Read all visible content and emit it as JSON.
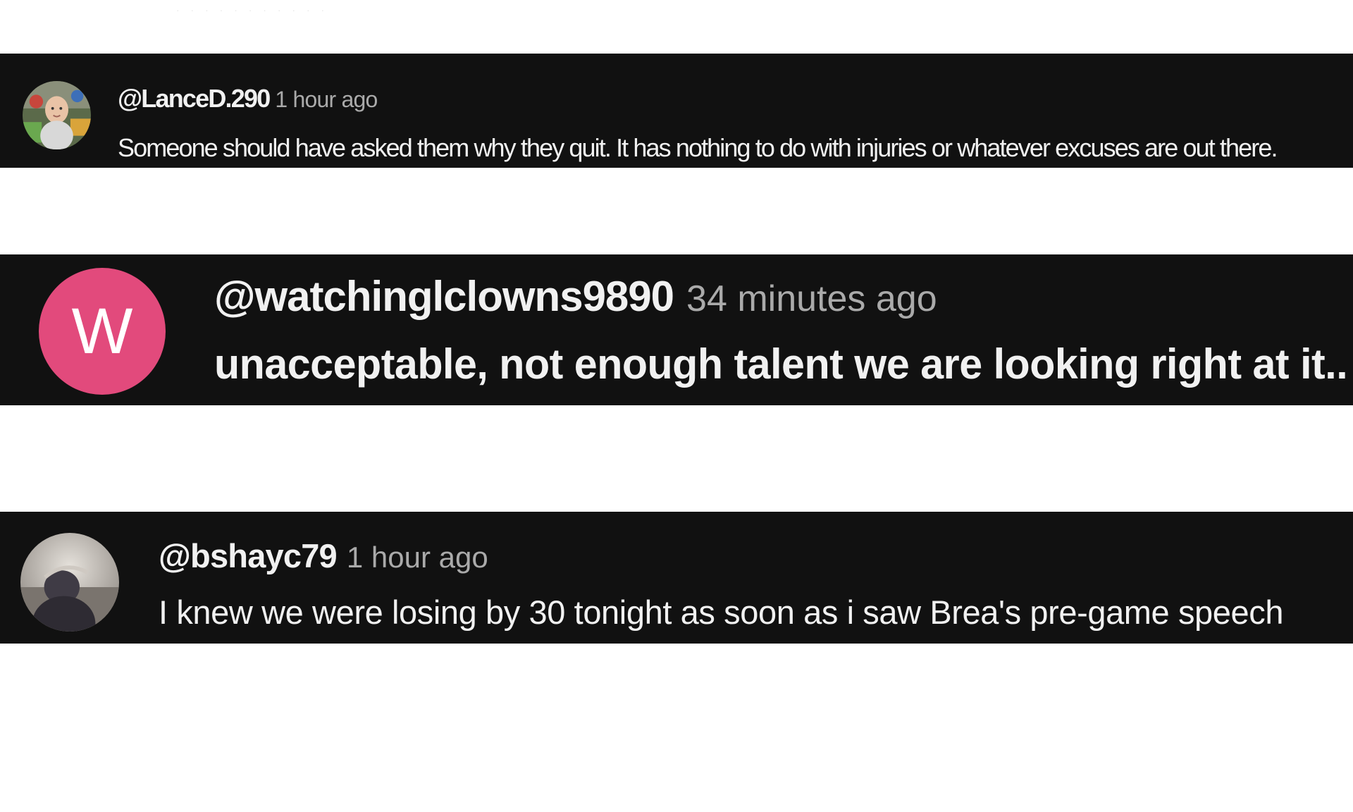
{
  "comments": [
    {
      "author": "@LanceD.290",
      "time": "1 hour ago",
      "text": "Someone should have asked them why they quit. It has nothing to do with injuries or whatever excuses are out there.",
      "avatar_type": "photo-baby"
    },
    {
      "author": "@watchinglclowns9890",
      "time": "34 minutes ago",
      "text": "unacceptable, not enough talent we are looking right at it..",
      "avatar_type": "letter",
      "avatar_letter": "W",
      "avatar_color": "#e24a7c"
    },
    {
      "author": "@bshayc79",
      "time": "1 hour ago",
      "text": "I knew we were losing by 30 tonight as soon as i saw Brea's pre-game speech",
      "avatar_type": "photo-person"
    }
  ],
  "colors": {
    "panel_background": "#111111",
    "author_text": "#f1f1f1",
    "timestamp_text": "#aaaaaa",
    "page_background": "#ffffff"
  }
}
